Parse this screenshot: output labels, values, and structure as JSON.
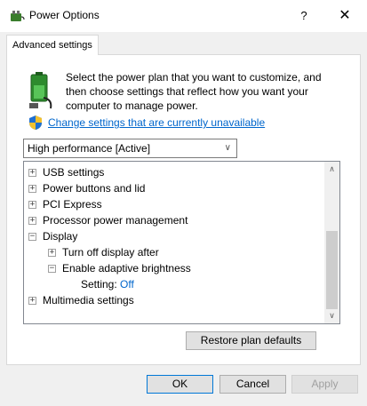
{
  "window": {
    "title": "Power Options",
    "help_label": "?",
    "close_label": "✕"
  },
  "tab": {
    "label": "Advanced settings"
  },
  "intro": {
    "text": "Select the power plan that you want to customize, and then choose settings that reflect how you want your computer to manage power."
  },
  "change_link": {
    "label": "Change settings that are currently unavailable"
  },
  "plan_select": {
    "value": "High performance [Active]"
  },
  "tree": {
    "items": [
      {
        "label": "USB settings",
        "expander": "+"
      },
      {
        "label": "Power buttons and lid",
        "expander": "+"
      },
      {
        "label": "PCI Express",
        "expander": "+"
      },
      {
        "label": "Processor power management",
        "expander": "+"
      },
      {
        "label": "Display",
        "expander": "−"
      },
      {
        "label": "Turn off display after",
        "expander": "+"
      },
      {
        "label": "Enable adaptive brightness",
        "expander": "−"
      },
      {
        "label": "Setting:",
        "value": "Off"
      },
      {
        "label": "Multimedia settings",
        "expander": "+"
      }
    ]
  },
  "buttons": {
    "restore": "Restore plan defaults",
    "ok": "OK",
    "cancel": "Cancel",
    "apply": "Apply"
  },
  "colors": {
    "link": "#0066cc",
    "default_button_border": "#0078d7"
  }
}
